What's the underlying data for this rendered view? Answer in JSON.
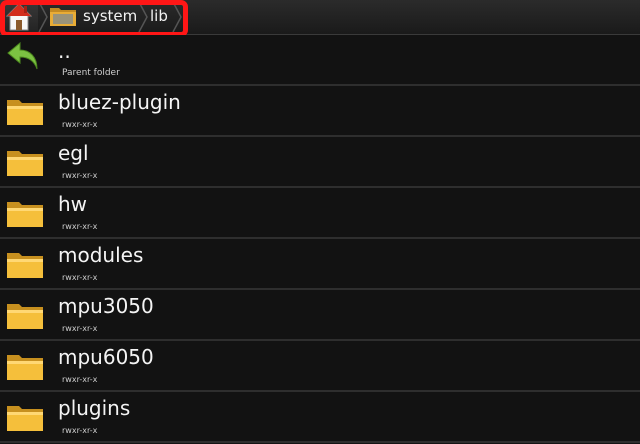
{
  "breadcrumb": {
    "items": [
      {
        "label": "system"
      },
      {
        "label": "lib"
      }
    ]
  },
  "list": {
    "parent": {
      "name": "..",
      "meta": "Parent folder"
    },
    "folders": [
      {
        "name": "bluez-plugin",
        "perms": "rwxr-xr-x"
      },
      {
        "name": "egl",
        "perms": "rwxr-xr-x"
      },
      {
        "name": "hw",
        "perms": "rwxr-xr-x"
      },
      {
        "name": "modules",
        "perms": "rwxr-xr-x"
      },
      {
        "name": "mpu3050",
        "perms": "rwxr-xr-x"
      },
      {
        "name": "mpu6050",
        "perms": "rwxr-xr-x"
      },
      {
        "name": "plugins",
        "perms": "rwxr-xr-x"
      }
    ]
  },
  "icons": {
    "home": "home-icon",
    "folder": "folder-icon",
    "parent": "back-arrow-icon"
  },
  "colors": {
    "highlight": "#ff1616",
    "folder": "#f3b733",
    "arrow": "#7cc242"
  }
}
